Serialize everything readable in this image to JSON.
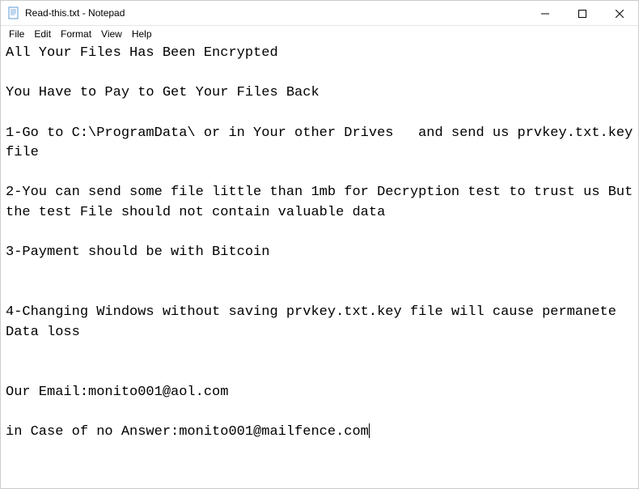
{
  "window": {
    "title": "Read-this.txt - Notepad",
    "icon_name": "notepad-icon"
  },
  "menu": {
    "file": "File",
    "edit": "Edit",
    "format": "Format",
    "view": "View",
    "help": "Help"
  },
  "document": {
    "text": "All Your Files Has Been Encrypted\n\nYou Have to Pay to Get Your Files Back\n\n1-Go to C:\\ProgramData\\ or in Your other Drives   and send us prvkey.txt.key  file\n\n2-You can send some file little than 1mb for Decryption test to trust us But the test File should not contain valuable data\n\n3-Payment should be with Bitcoin\n\n\n4-Changing Windows without saving prvkey.txt.key file will cause permanete Data loss\n\n\nOur Email:monito001@aol.com\n\nin Case of no Answer:monito001@mailfence.com"
  }
}
